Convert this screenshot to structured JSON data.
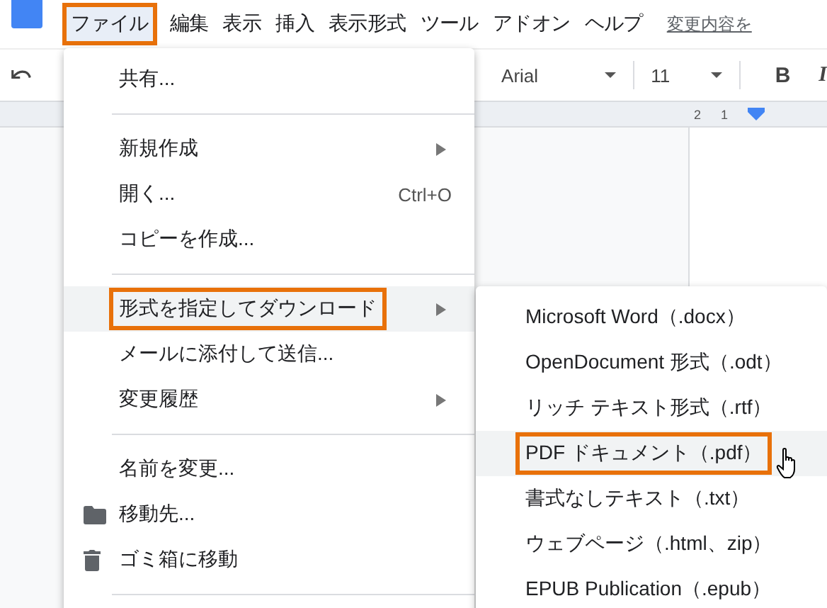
{
  "menubar": {
    "items": [
      {
        "label": "ファイル",
        "selected": true,
        "outlined": true
      },
      {
        "label": "編集",
        "selected": false,
        "outlined": false
      },
      {
        "label": "表示",
        "selected": false,
        "outlined": false
      },
      {
        "label": "挿入",
        "selected": false,
        "outlined": false
      },
      {
        "label": "表示形式",
        "selected": false,
        "outlined": false
      },
      {
        "label": "ツール",
        "selected": false,
        "outlined": false
      },
      {
        "label": "アドオン",
        "selected": false,
        "outlined": false
      },
      {
        "label": "ヘルプ",
        "selected": false,
        "outlined": false
      }
    ],
    "link": "変更内容を"
  },
  "toolbar": {
    "font": "Arial",
    "size": "11",
    "bold": "B",
    "italic": "I"
  },
  "ruler": {
    "marks": [
      "2",
      "1"
    ]
  },
  "file_menu": {
    "items": [
      {
        "kind": "item",
        "label": "共有...",
        "selected": false,
        "outlined": false,
        "submenu": false
      },
      {
        "kind": "divider"
      },
      {
        "kind": "item",
        "label": "新規作成",
        "selected": false,
        "outlined": false,
        "submenu": true
      },
      {
        "kind": "item",
        "label": "開く...",
        "shortcut": "Ctrl+O",
        "selected": false,
        "outlined": false,
        "submenu": false
      },
      {
        "kind": "item",
        "label": "コピーを作成...",
        "selected": false,
        "outlined": false,
        "submenu": false
      },
      {
        "kind": "divider"
      },
      {
        "kind": "item",
        "label": "形式を指定してダウンロード",
        "selected": true,
        "outlined": true,
        "submenu": true
      },
      {
        "kind": "item",
        "label": "メールに添付して送信...",
        "selected": false,
        "outlined": false,
        "submenu": false
      },
      {
        "kind": "item",
        "label": "変更履歴",
        "selected": false,
        "outlined": false,
        "submenu": true
      },
      {
        "kind": "divider"
      },
      {
        "kind": "item",
        "label": "名前を変更...",
        "selected": false,
        "outlined": false,
        "submenu": false
      },
      {
        "kind": "folder_item",
        "label": "移動先...",
        "selected": false,
        "outlined": false,
        "submenu": false
      },
      {
        "kind": "trash_item",
        "label": "ゴミ箱に移動",
        "selected": false,
        "outlined": false,
        "submenu": false
      },
      {
        "kind": "divider"
      }
    ]
  },
  "download_menu": {
    "items": [
      {
        "label": "Microsoft Word（.docx）",
        "selected": false,
        "outlined": false
      },
      {
        "label": "OpenDocument 形式（.odt）",
        "selected": false,
        "outlined": false
      },
      {
        "label": "リッチ テキスト形式（.rtf）",
        "selected": false,
        "outlined": false
      },
      {
        "label": "PDF ドキュメント（.pdf）",
        "selected": true,
        "outlined": true
      },
      {
        "label": "書式なしテキスト（.txt）",
        "selected": false,
        "outlined": false
      },
      {
        "label": "ウェブページ（.html、zip）",
        "selected": false,
        "outlined": false
      },
      {
        "label": "EPUB Publication（.epub）",
        "selected": false,
        "outlined": false
      }
    ]
  }
}
